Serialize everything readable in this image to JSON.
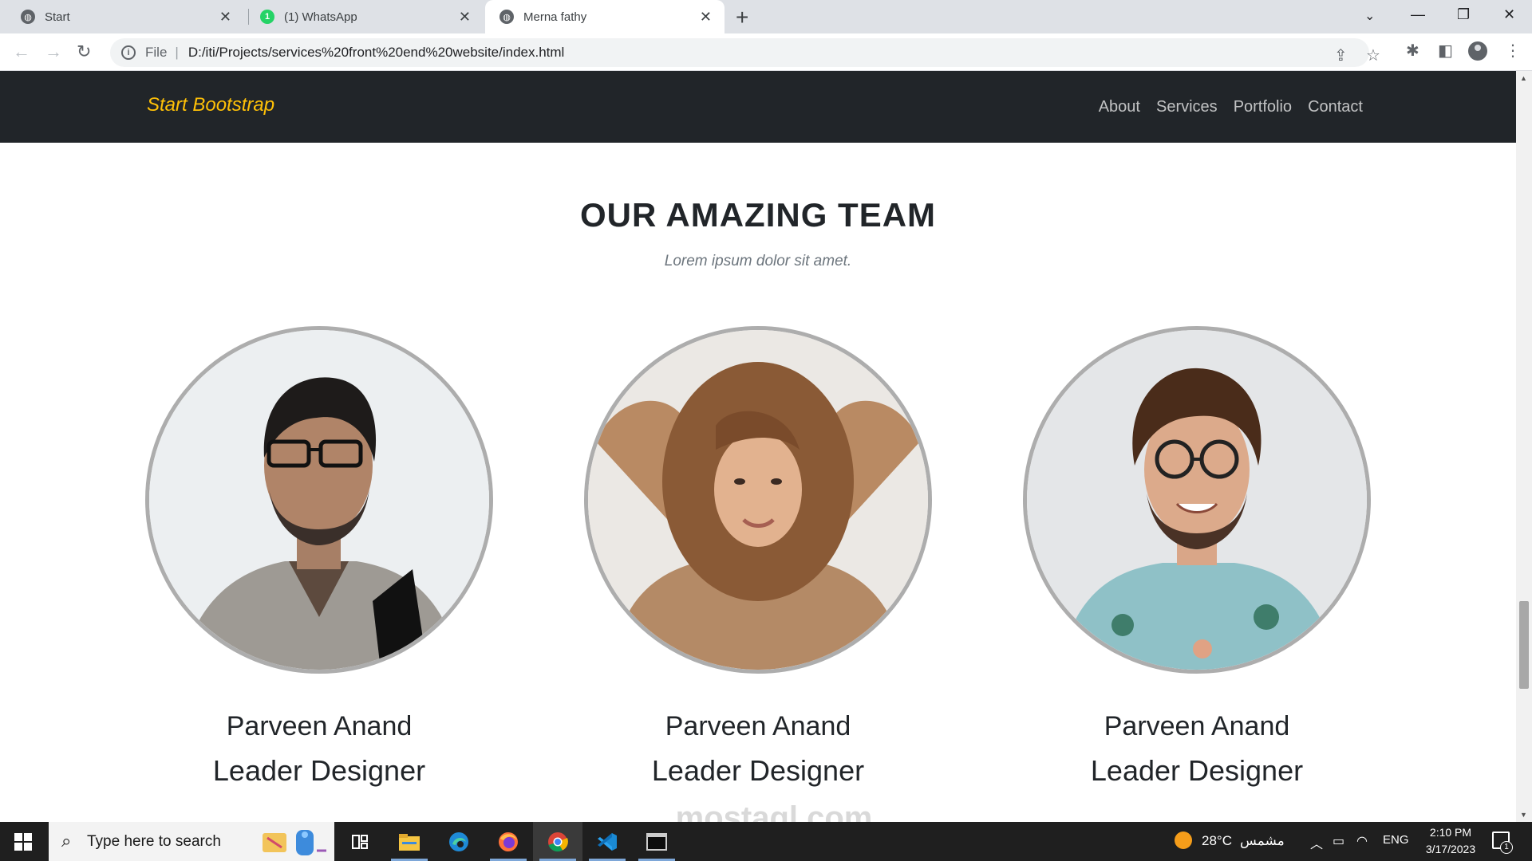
{
  "browser": {
    "tabs": [
      {
        "title": "Start",
        "favicon": "globe-icon"
      },
      {
        "title": "(1) WhatsApp",
        "favicon": "whatsapp-icon",
        "badge": "1"
      },
      {
        "title": "Merna fathy",
        "favicon": "globe-icon",
        "active": true
      }
    ],
    "address": {
      "scheme_label": "File",
      "url": "D:/iti/Projects/services%20front%20end%20website/index.html"
    }
  },
  "site": {
    "brand": "Start Bootstrap",
    "nav": [
      "About",
      "Services",
      "Portfolio",
      "Contact"
    ],
    "team": {
      "title": "OUR AMAZING TEAM",
      "subtitle": "Lorem ipsum dolor sit amet.",
      "members": [
        {
          "name": "Parveen Anand",
          "role": "Leader Designer"
        },
        {
          "name": "Parveen Anand",
          "role": "Leader Designer"
        },
        {
          "name": "Parveen Anand",
          "role": "Leader Designer"
        }
      ]
    },
    "watermark": "mostaql.com"
  },
  "taskbar": {
    "search_placeholder": "Type here to search",
    "weather": {
      "temp": "28°C",
      "condition": "مشمس"
    },
    "language": "ENG",
    "time": "2:10 PM",
    "date": "3/17/2023",
    "notifications": "1"
  },
  "colors": {
    "navbar_bg": "#212529",
    "brand": "#ffc107",
    "photo_border": "#adadad",
    "taskbar_bg": "#1f1f1f"
  }
}
